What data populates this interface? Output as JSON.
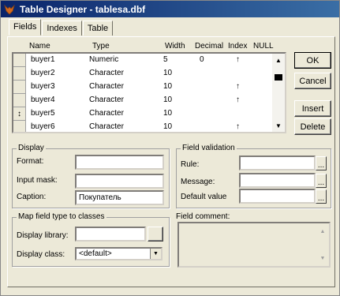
{
  "window": {
    "title": "Table Designer - tablesa.dbf",
    "icon": "fox-icon"
  },
  "tabs": [
    {
      "label": "Fields",
      "active": true
    },
    {
      "label": "Indexes",
      "active": false
    },
    {
      "label": "Table",
      "active": false
    }
  ],
  "grid": {
    "columns": [
      "Name",
      "Type",
      "Width",
      "Decimal",
      "Index",
      "NULL"
    ],
    "rows": [
      {
        "name": "buyer1",
        "type": "Numeric",
        "width": "5",
        "decimal": "0",
        "index": "↑",
        "marker": ""
      },
      {
        "name": "buyer2",
        "type": "Character",
        "width": "10",
        "decimal": "",
        "index": "",
        "marker": ""
      },
      {
        "name": "buyer3",
        "type": "Character",
        "width": "10",
        "decimal": "",
        "index": "↑",
        "marker": ""
      },
      {
        "name": "buyer4",
        "type": "Character",
        "width": "10",
        "decimal": "",
        "index": "↑",
        "marker": ""
      },
      {
        "name": "buyer5",
        "type": "Character",
        "width": "10",
        "decimal": "",
        "index": "",
        "marker": "↕"
      },
      {
        "name": "buyer6",
        "type": "Character",
        "width": "10",
        "decimal": "",
        "index": "↑",
        "marker": ""
      }
    ]
  },
  "buttons": {
    "ok": "OK",
    "cancel": "Cancel",
    "insert": "Insert",
    "delete": "Delete"
  },
  "display": {
    "legend": "Display",
    "format_label": "Format:",
    "format_value": "",
    "input_mask_label": "Input mask:",
    "input_mask_value": "",
    "caption_label": "Caption:",
    "caption_value": "Покупатель"
  },
  "validation": {
    "legend": "Field validation",
    "rule_label": "Rule:",
    "rule_value": "",
    "message_label": "Message:",
    "message_value": "",
    "default_label": "Default value",
    "default_value": "",
    "ellipsis": "..."
  },
  "mapping": {
    "legend": "Map field type to classes",
    "library_label": "Display library:",
    "library_value": "",
    "class_label": "Display class:",
    "class_value": "<default>"
  },
  "comment": {
    "label": "Field comment:",
    "value": ""
  }
}
